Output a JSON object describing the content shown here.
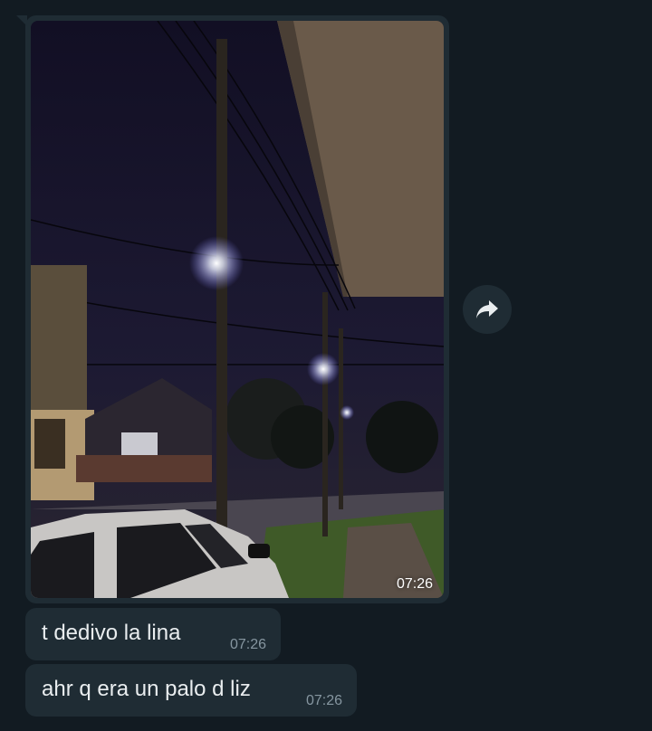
{
  "messages": [
    {
      "type": "image",
      "time": "07:26"
    },
    {
      "type": "text",
      "text": "t dedivo la lina",
      "time": "07:26"
    },
    {
      "type": "text",
      "text": "ahr q era un palo d liz",
      "time": "07:26"
    }
  ],
  "icons": {
    "forward": "forward-arrow-icon"
  },
  "colors": {
    "background": "#121b22",
    "bubble": "#1f2c34",
    "text": "#e9edef",
    "timestamp": "#8696a0"
  }
}
